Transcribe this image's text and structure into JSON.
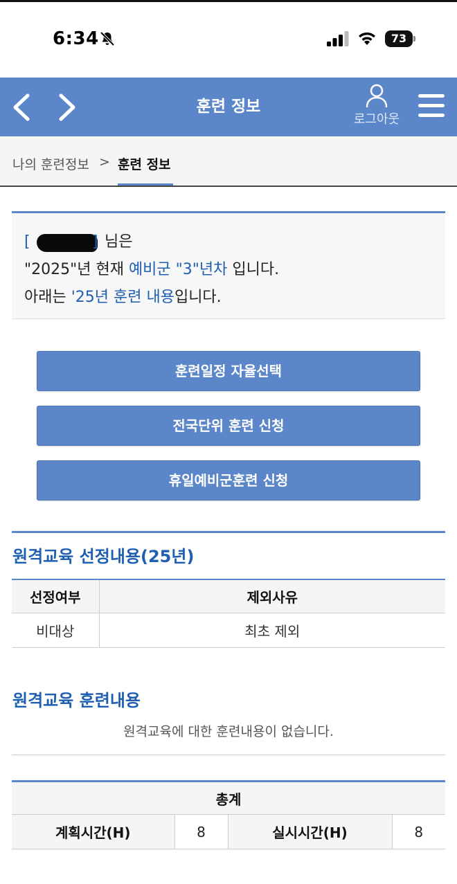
{
  "status_bar": {
    "time": "6:34",
    "battery": "73",
    "icons": [
      "bell-slash-icon",
      "cellular-signal-icon",
      "wifi-icon",
      "battery-icon"
    ]
  },
  "header": {
    "title": "훈련 정보",
    "logout_label": "로그아웃",
    "icons": [
      "chevron-left-icon",
      "chevron-right-icon",
      "person-icon",
      "hamburger-menu-icon"
    ],
    "accent_color": "#5b86c9"
  },
  "breadcrumb": {
    "parent": "나의 훈련정보",
    "separator": ">",
    "current": "훈련 정보"
  },
  "info": {
    "name_open": "[",
    "name_close": "]",
    "name_suffix": " 님은",
    "line2_a": "\"2025\"년 현재 ",
    "line2_b": "예비군 \"3\"년차",
    "line2_c": " 입니다.",
    "line3_a": "아래는 ",
    "line3_b": "'25년 훈련 내용",
    "line3_c": "입니다.",
    "highlight_color": "#1f5fb1"
  },
  "buttons": {
    "schedule": "훈련일정 자율선택",
    "nationwide": "전국단위 훈련 신청",
    "holiday": "휴일예비군훈련 신청"
  },
  "remote_selection": {
    "title": "원격교육 선정내용(25년)",
    "columns": [
      "선정여부",
      "제외사유"
    ],
    "rows": [
      [
        "비대상",
        "최초 제외"
      ]
    ]
  },
  "remote_training": {
    "title": "원격교육 훈련내용",
    "empty_message": "원격교육에 대한 훈련내용이 없습니다."
  },
  "totals": {
    "title": "총계",
    "planned_label": "계획시간(H)",
    "planned_value": "8",
    "actual_label": "실시시간(H)",
    "actual_value": "8"
  }
}
